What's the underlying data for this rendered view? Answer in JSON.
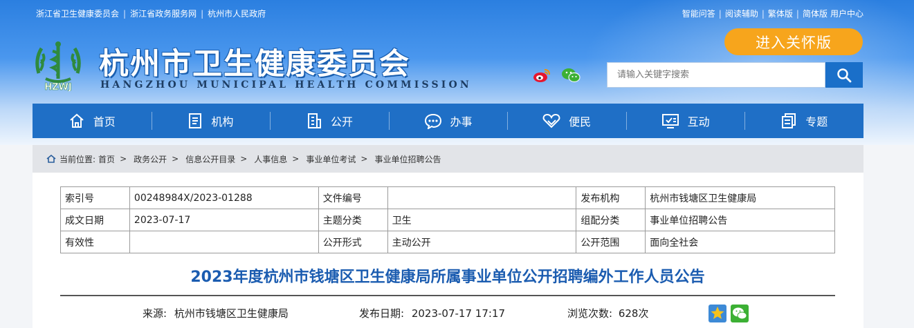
{
  "top_links_left": [
    "浙江省卫生健康委员会",
    "浙江省政务服务网",
    "杭州市人民政府"
  ],
  "top_links_right": [
    "智能问答",
    "阅读辅助",
    "繁体版",
    "简体版",
    "用户中心"
  ],
  "site": {
    "title": "杭州市卫生健康委员会",
    "subtitle": "HANGZHOU MUNICIPAL HEALTH COMMISSION",
    "logo_text": "HZWJ"
  },
  "care_button": "进入关怀版",
  "search": {
    "placeholder": "请输入关键字搜索"
  },
  "nav": [
    {
      "label": "首页",
      "icon": "home-icon"
    },
    {
      "label": "机构",
      "icon": "building-doc-icon"
    },
    {
      "label": "公开",
      "icon": "office-building-icon"
    },
    {
      "label": "办事",
      "icon": "chat-dots-icon"
    },
    {
      "label": "便民",
      "icon": "heart-hands-icon"
    },
    {
      "label": "互动",
      "icon": "monitor-check-icon"
    },
    {
      "label": "专题",
      "icon": "document-stack-icon"
    }
  ],
  "breadcrumb": {
    "label": "当前位置:",
    "items": [
      "首页",
      "政务公开",
      "信息公开目录",
      "人事信息",
      "事业单位考试",
      "事业单位招聘公告"
    ]
  },
  "meta": {
    "index_no_label": "索引号",
    "index_no": "00248984X/2023-01288",
    "doc_no_label": "文件编号",
    "doc_no": "",
    "issuer_label": "发布机构",
    "issuer": "杭州市钱塘区卫生健康局",
    "date_label": "成文日期",
    "date": "2023-07-17",
    "topic_label": "主题分类",
    "topic": "卫生",
    "category_label": "组配分类",
    "category": "事业单位招聘公告",
    "validity_label": "有效性",
    "validity": "",
    "form_label": "公开形式",
    "form": "主动公开",
    "scope_label": "公开范围",
    "scope": "面向全社会"
  },
  "article": {
    "title": "2023年度杭州市钱塘区卫生健康局所属事业单位公开招聘编外工作人员公告",
    "source_label": "来源:",
    "source": "杭州市钱塘区卫生健康局",
    "publish_label": "发布日期:",
    "publish_date": "2023-07-17 17:17",
    "views_label": "浏览次数:",
    "views": "628次"
  },
  "colors": {
    "nav_bg": "#1f6fc6",
    "care_btn": "#f7a51c",
    "title": "#1b5cb0"
  }
}
